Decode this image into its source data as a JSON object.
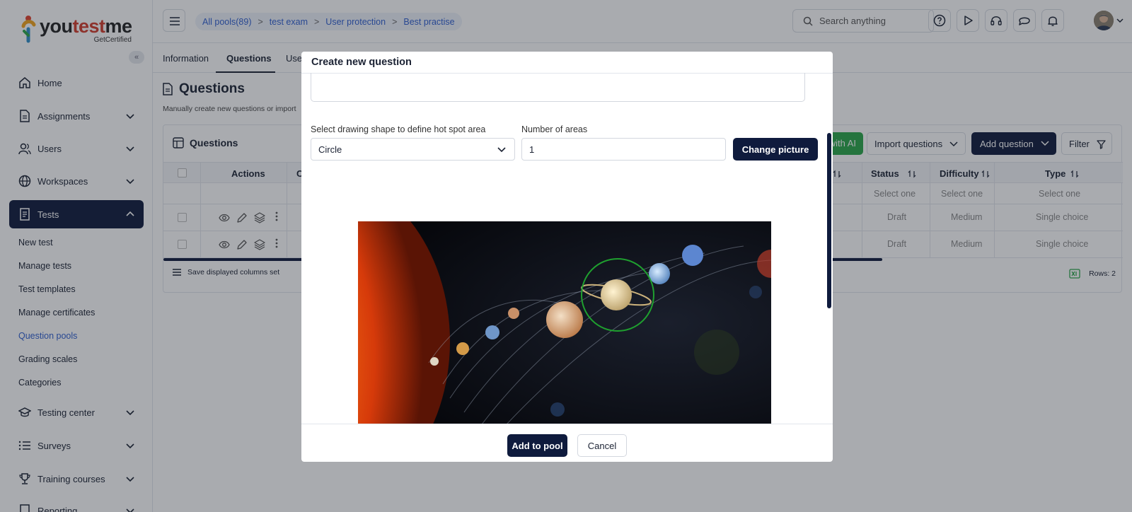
{
  "brand": {
    "name_part1": "you",
    "name_part2": "test",
    "name_part3": "me",
    "tagline": "GetCertified"
  },
  "sidebar": {
    "collapse_label": "«",
    "items": [
      {
        "label": "Home",
        "icon": "home-icon",
        "expandable": false
      },
      {
        "label": "Assignments",
        "icon": "document-icon",
        "expandable": true
      },
      {
        "label": "Users",
        "icon": "users-icon",
        "expandable": true
      },
      {
        "label": "Workspaces",
        "icon": "globe-icon",
        "expandable": true
      },
      {
        "label": "Tests",
        "icon": "tests-icon",
        "expandable": true,
        "active": true
      },
      {
        "label": "Testing center",
        "icon": "graduation-cap-icon",
        "expandable": true
      },
      {
        "label": "Surveys",
        "icon": "list-icon",
        "expandable": true
      },
      {
        "label": "Training courses",
        "icon": "trophy-icon",
        "expandable": true
      },
      {
        "label": "Reporting",
        "icon": "report-icon",
        "expandable": true
      }
    ],
    "sub_items": [
      "New test",
      "Manage tests",
      "Test templates",
      "Manage certificates",
      "Question pools",
      "Grading scales",
      "Categories"
    ],
    "selected_sub": "Question pools"
  },
  "topbar": {
    "breadcrumbs": [
      "All pools(89)",
      "test exam",
      "User protection",
      "Best practise"
    ],
    "separator": ">",
    "search_placeholder": "Search anything"
  },
  "tabs": [
    "Information",
    "Questions",
    "Use"
  ],
  "page": {
    "title": "Questions",
    "description": "Manually create new questions or import"
  },
  "panel": {
    "title": "Questions",
    "ai_button": "with AI",
    "import_button": "Import questions",
    "add_button": "Add question",
    "filter_button": "Filter",
    "columns": {
      "actions": "Actions",
      "c": "C",
      "status": "Status",
      "difficulty": "Difficulty",
      "type": "Type"
    },
    "filter_placeholder": "Select one",
    "rows": [
      {
        "status": "Draft",
        "difficulty": "Medium",
        "type": "Single choice"
      },
      {
        "status": "Draft",
        "difficulty": "Medium",
        "type": "Single choice"
      }
    ],
    "save_columns_label": "Save displayed columns set",
    "rows_count_label": "Rows: 2"
  },
  "modal": {
    "title": "Create new question",
    "shape_label": "Select drawing shape to define hot spot area",
    "shape_value": "Circle",
    "areas_label": "Number of areas",
    "areas_value": "1",
    "change_picture_button": "Change picture",
    "add_to_pool_button": "Add to pool",
    "cancel_button": "Cancel"
  },
  "colors": {
    "primary": "#0f1b3d",
    "link": "#2f5fd0",
    "ai_green": "#2aa64a",
    "hotspot_stroke": "#1fa02f"
  }
}
